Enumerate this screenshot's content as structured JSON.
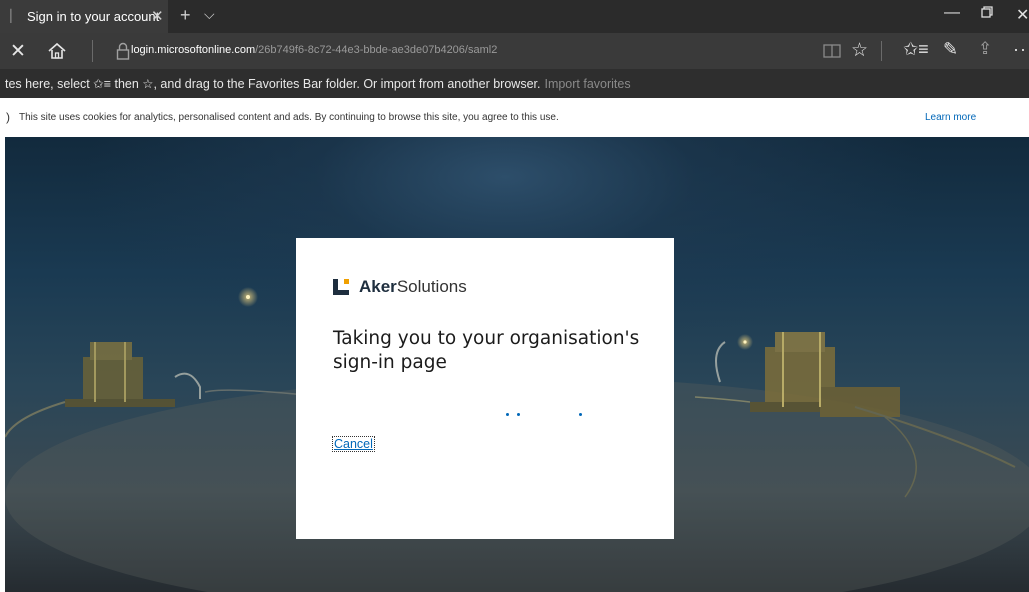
{
  "browser": {
    "tab": {
      "title": "Sign in to your account",
      "close_glyph": "✕",
      "favicon": "page-icon"
    },
    "new_tab_glyph": "+",
    "tab_menu_glyph": "⌵",
    "window_controls": {
      "minimize": "—",
      "maximize": "🗗",
      "close": "✕"
    },
    "address": {
      "domain": "login.microsoftonline.com",
      "path": "/26b749f6-8c72-44e3-bbde-ae3de07b4206/saml2"
    },
    "toolbar": {
      "stop_glyph": "✕",
      "favorite_glyph": "☆",
      "favorites_hub_glyph": "✩≡",
      "notes_glyph": "✎",
      "share_glyph": "⇪",
      "more_glyph": "···"
    }
  },
  "favorites_bar": {
    "text": "tes here, select ✩≡ then ☆, and drag to the Favorites Bar folder. Or import from another browser.",
    "import_link": "Import favorites"
  },
  "cookie_banner": {
    "paren": ")",
    "text": "This site uses cookies for analytics, personalised content and ads. By continuing to browse this site, you agree to this use.",
    "learn_more": "Learn more"
  },
  "dialog": {
    "logo_bold": "Aker",
    "logo_light": "Solutions",
    "heading": "Taking you to your organisation's sign-in page",
    "cancel": "Cancel"
  },
  "colors": {
    "accent": "#0067b8",
    "logo_navy": "#1e2e3e",
    "logo_orange": "#f0a000"
  }
}
